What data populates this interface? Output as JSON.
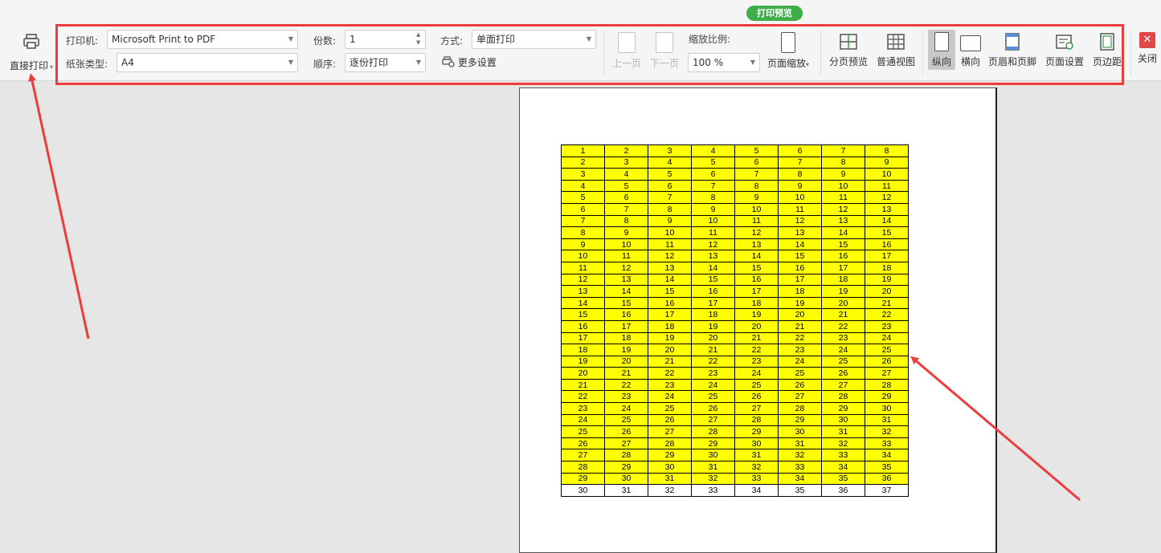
{
  "ribbon": {
    "badge": "打印预览",
    "direct_print": {
      "label": "直接打印",
      "caret": "▾"
    },
    "printer": {
      "label": "打印机:",
      "value": "Microsoft Print to PDF"
    },
    "paper": {
      "label": "纸张类型:",
      "value": "A4"
    },
    "copies": {
      "label": "份数:",
      "value": "1"
    },
    "order": {
      "label": "顺序:",
      "value": "逐份打印"
    },
    "mode": {
      "label": "方式:",
      "value": "单面打印"
    },
    "more_settings": "更多设置",
    "prev_page": "上一页",
    "next_page": "下一页",
    "zoom": {
      "label": "缩放比例:",
      "value": "100 %"
    },
    "page_scale": "页面缩放",
    "page_break_preview": "分页预览",
    "normal_view": "普通视图",
    "portrait": "纵向",
    "landscape": "横向",
    "header_footer": "页眉和页脚",
    "page_setup": "页面设置",
    "margins": "页边距",
    "close": "关闭",
    "accent_green": "#3fae49",
    "annotation_red": "#ee3b3b"
  },
  "sheet": {
    "highlight_color": "#ffff00",
    "rows": [
      {
        "fill": "yellow",
        "cells": [
          "1",
          "2",
          "3",
          "4",
          "5",
          "6",
          "7",
          "8"
        ]
      },
      {
        "fill": "yellow",
        "cells": [
          "2",
          "3",
          "4",
          "5",
          "6",
          "7",
          "8",
          "9"
        ]
      },
      {
        "fill": "yellow",
        "cells": [
          "3",
          "4",
          "5",
          "6",
          "7",
          "8",
          "9",
          "10"
        ]
      },
      {
        "fill": "yellow",
        "cells": [
          "4",
          "5",
          "6",
          "7",
          "8",
          "9",
          "10",
          "11"
        ]
      },
      {
        "fill": "yellow",
        "cells": [
          "5",
          "6",
          "7",
          "8",
          "9",
          "10",
          "11",
          "12"
        ]
      },
      {
        "fill": "yellow",
        "cells": [
          "6",
          "7",
          "8",
          "9",
          "10",
          "11",
          "12",
          "13"
        ]
      },
      {
        "fill": "yellow",
        "cells": [
          "7",
          "8",
          "9",
          "10",
          "11",
          "12",
          "13",
          "14"
        ]
      },
      {
        "fill": "yellow",
        "cells": [
          "8",
          "9",
          "10",
          "11",
          "12",
          "13",
          "14",
          "15"
        ]
      },
      {
        "fill": "yellow",
        "cells": [
          "9",
          "10",
          "11",
          "12",
          "13",
          "14",
          "15",
          "16"
        ]
      },
      {
        "fill": "yellow",
        "cells": [
          "10",
          "11",
          "12",
          "13",
          "14",
          "15",
          "16",
          "17"
        ]
      },
      {
        "fill": "yellow",
        "cells": [
          "11",
          "12",
          "13",
          "14",
          "15",
          "16",
          "17",
          "18"
        ]
      },
      {
        "fill": "yellow",
        "cells": [
          "12",
          "13",
          "14",
          "15",
          "16",
          "17",
          "18",
          "19"
        ]
      },
      {
        "fill": "yellow",
        "cells": [
          "13",
          "14",
          "15",
          "16",
          "17",
          "18",
          "19",
          "20"
        ]
      },
      {
        "fill": "yellow",
        "cells": [
          "14",
          "15",
          "16",
          "17",
          "18",
          "19",
          "20",
          "21"
        ]
      },
      {
        "fill": "yellow",
        "cells": [
          "15",
          "16",
          "17",
          "18",
          "19",
          "20",
          "21",
          "22"
        ]
      },
      {
        "fill": "yellow",
        "cells": [
          "16",
          "17",
          "18",
          "19",
          "20",
          "21",
          "22",
          "23"
        ]
      },
      {
        "fill": "yellow",
        "cells": [
          "17",
          "18",
          "19",
          "20",
          "21",
          "22",
          "23",
          "24"
        ]
      },
      {
        "fill": "yellow",
        "cells": [
          "18",
          "19",
          "20",
          "21",
          "22",
          "23",
          "24",
          "25"
        ]
      },
      {
        "fill": "yellow",
        "cells": [
          "19",
          "20",
          "21",
          "22",
          "23",
          "24",
          "25",
          "26"
        ]
      },
      {
        "fill": "yellow",
        "cells": [
          "20",
          "21",
          "22",
          "23",
          "24",
          "25",
          "26",
          "27"
        ]
      },
      {
        "fill": "yellow",
        "cells": [
          "21",
          "22",
          "23",
          "24",
          "25",
          "26",
          "27",
          "28"
        ]
      },
      {
        "fill": "yellow",
        "cells": [
          "22",
          "23",
          "24",
          "25",
          "26",
          "27",
          "28",
          "29"
        ]
      },
      {
        "fill": "yellow",
        "cells": [
          "23",
          "24",
          "25",
          "26",
          "27",
          "28",
          "29",
          "30"
        ]
      },
      {
        "fill": "yellow",
        "cells": [
          "24",
          "25",
          "26",
          "27",
          "28",
          "29",
          "30",
          "31"
        ]
      },
      {
        "fill": "yellow",
        "cells": [
          "25",
          "26",
          "27",
          "28",
          "29",
          "30",
          "31",
          "32"
        ]
      },
      {
        "fill": "yellow",
        "cells": [
          "26",
          "27",
          "28",
          "29",
          "30",
          "31",
          "32",
          "33"
        ]
      },
      {
        "fill": "yellow",
        "cells": [
          "27",
          "28",
          "29",
          "30",
          "31",
          "32",
          "33",
          "34"
        ]
      },
      {
        "fill": "yellow",
        "cells": [
          "28",
          "29",
          "30",
          "31",
          "32",
          "33",
          "34",
          "35"
        ]
      },
      {
        "fill": "yellow",
        "cells": [
          "29",
          "30",
          "31",
          "32",
          "33",
          "34",
          "35",
          "36"
        ]
      },
      {
        "fill": "white",
        "cells": [
          "30",
          "31",
          "32",
          "33",
          "34",
          "35",
          "36",
          "37"
        ]
      }
    ]
  }
}
